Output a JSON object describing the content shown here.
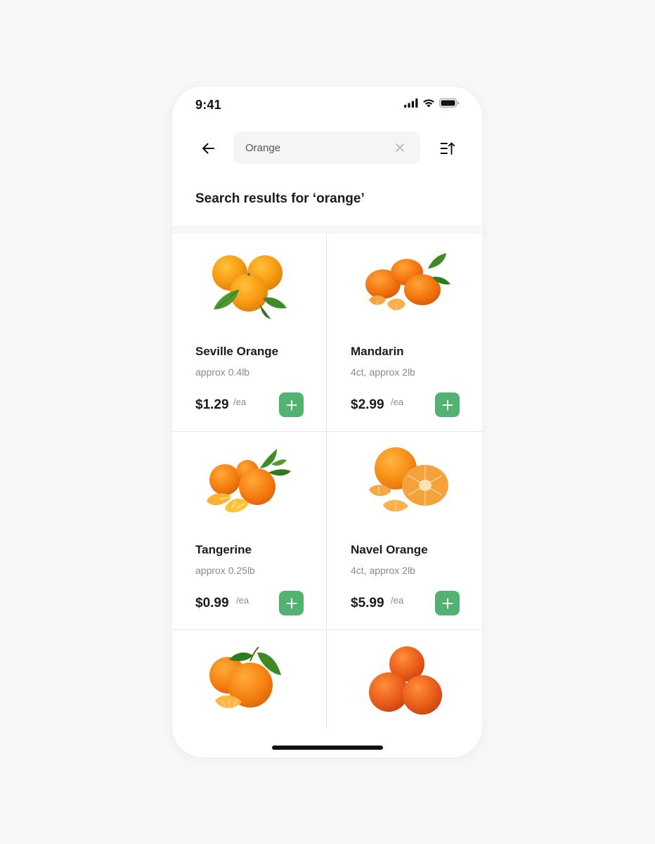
{
  "status_bar": {
    "time": "9:41",
    "icons": [
      "signal-icon",
      "wifi-icon",
      "battery-icon"
    ]
  },
  "header": {
    "back_icon": "arrow-left-icon",
    "search": {
      "value": "Orange",
      "placeholder": "Search"
    },
    "clear_icon": "close-icon",
    "sort_icon": "sort-icon"
  },
  "results": {
    "title": "Search results for ‘orange’"
  },
  "products": [
    {
      "name": "Seville Orange",
      "qty": "approx 0.4lb",
      "price": "$1.29",
      "unit": "/ea",
      "image": "seville-orange-image"
    },
    {
      "name": "Mandarin",
      "qty": "4ct, approx 2lb",
      "price": "$2.99",
      "unit": "/ea",
      "image": "mandarin-image"
    },
    {
      "name": "Tangerine",
      "qty": "approx 0.25lb",
      "price": "$0.99",
      "unit": "/ea",
      "image": "tangerine-image"
    },
    {
      "name": "Navel Orange",
      "qty": "4ct, approx 2lb",
      "price": "$5.99",
      "unit": "/ea",
      "image": "navel-orange-image"
    },
    {
      "name": "",
      "qty": "",
      "price": "",
      "unit": "",
      "image": "orange-with-leaves-image"
    },
    {
      "name": "",
      "qty": "",
      "price": "",
      "unit": "",
      "image": "blood-orange-stack-image"
    }
  ],
  "colors": {
    "accent": "#52b26f",
    "background": "#f7f7f7",
    "text_primary": "#1b1b1b",
    "text_secondary": "#8a8a8a"
  }
}
